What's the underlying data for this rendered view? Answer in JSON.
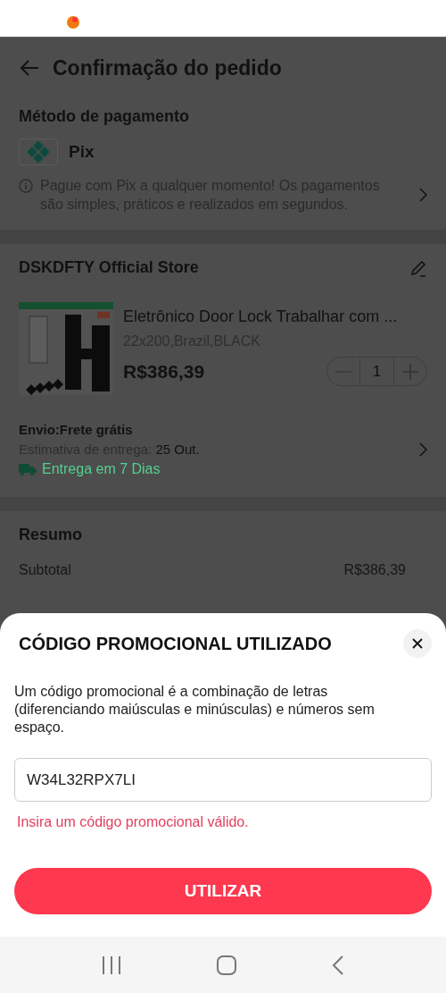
{
  "header": {
    "title": "Confirmação do pedido"
  },
  "payment": {
    "heading": "Método de pagamento",
    "method": "Pix",
    "info": "Pague com Pix a qualquer momento! Os pagamentos são simples, práticos e realizados em segundos."
  },
  "store": {
    "name": "DSKDFTY Official Store",
    "product": {
      "kind": "picture",
      "title": "Eletrônico Door Lock Trabalhar com ...",
      "variant": "22x200,Brazil,BLACK",
      "price": "R$386,39",
      "quantity": "1"
    },
    "shipping": {
      "label": "Envio:Frete grátis",
      "estimate_label": "Estimativa de entrega:",
      "estimate_date": "25 Out.",
      "delivery": "Entrega em 7 Dias"
    }
  },
  "summary": {
    "heading": "Resumo",
    "rows": [
      {
        "label": "Subtotal",
        "value": "R$386,39"
      }
    ]
  },
  "promo_sheet": {
    "title": "CÓDIGO PROMOCIONAL UTILIZADO",
    "description": "Um código promocional é a combinação de letras (diferenciando maiúsculas e minúsculas) e números sem espaço.",
    "code": "W34L32RPX7LI",
    "error": "Insira um código promocional válido.",
    "button": "UTILIZAR"
  }
}
